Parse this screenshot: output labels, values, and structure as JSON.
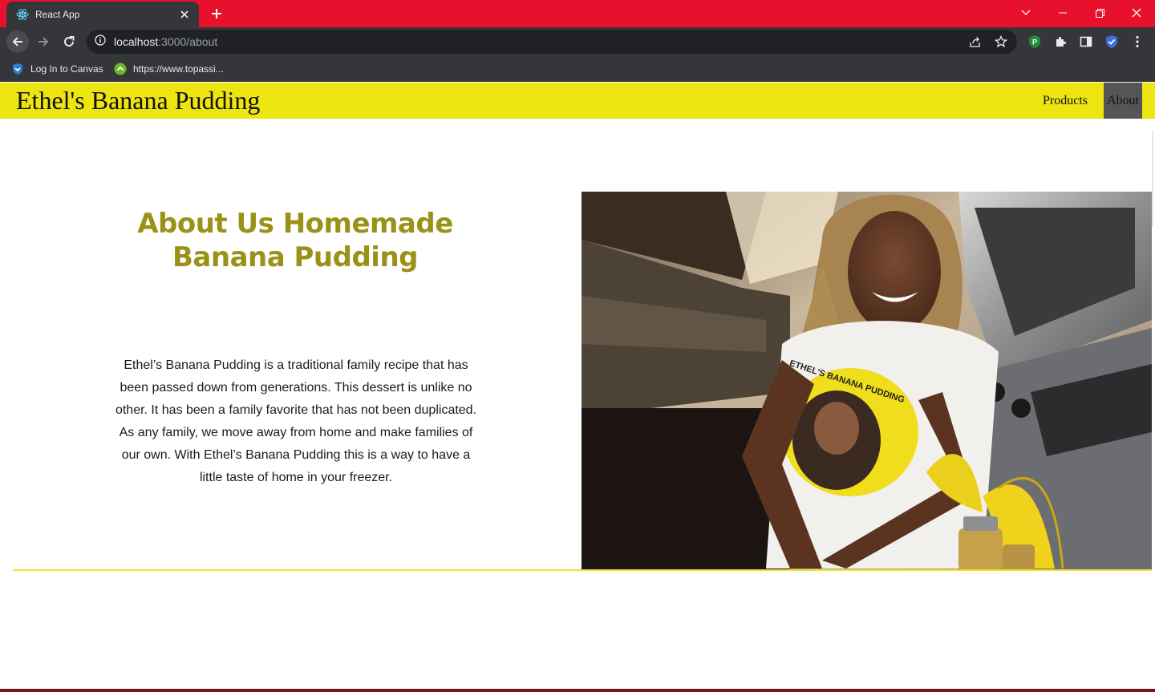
{
  "browser": {
    "tab_title": "React App",
    "url_host": "localhost",
    "url_path": ":3000/about",
    "bookmarks": [
      {
        "label": "Log In to Canvas",
        "icon": "shield-icon"
      },
      {
        "label": "https://www.topassi...",
        "icon": "green-circle-icon"
      }
    ],
    "extensions": [
      {
        "name": "p-extension-icon",
        "letter": "P"
      },
      {
        "name": "puzzle-icon"
      },
      {
        "name": "side-panel-icon"
      },
      {
        "name": "bitwarden-check-icon"
      }
    ]
  },
  "site": {
    "brand": "Ethel's Banana Pudding",
    "nav": {
      "products": "Products",
      "about": "About"
    }
  },
  "about": {
    "heading_line1": "About Us Homemade",
    "heading_line2": "Banana Pudding",
    "body": "Ethel’s Banana Pudding is a traditional family recipe that has been passed down from generations. This dessert is unlike no other. It has been a family favorite that has not been duplicated. As any family, we move away from home and make families of our own. With Ethel’s Banana Pudding this is a way to have a little taste of home in your freezer.",
    "shirt_text": "ETHEL'S BANANA PUDDING"
  },
  "colors": {
    "tabstrip": "#e8112d",
    "nav_bg": "#ede510",
    "heading": "#9b9117",
    "divider": "#efe22a"
  }
}
